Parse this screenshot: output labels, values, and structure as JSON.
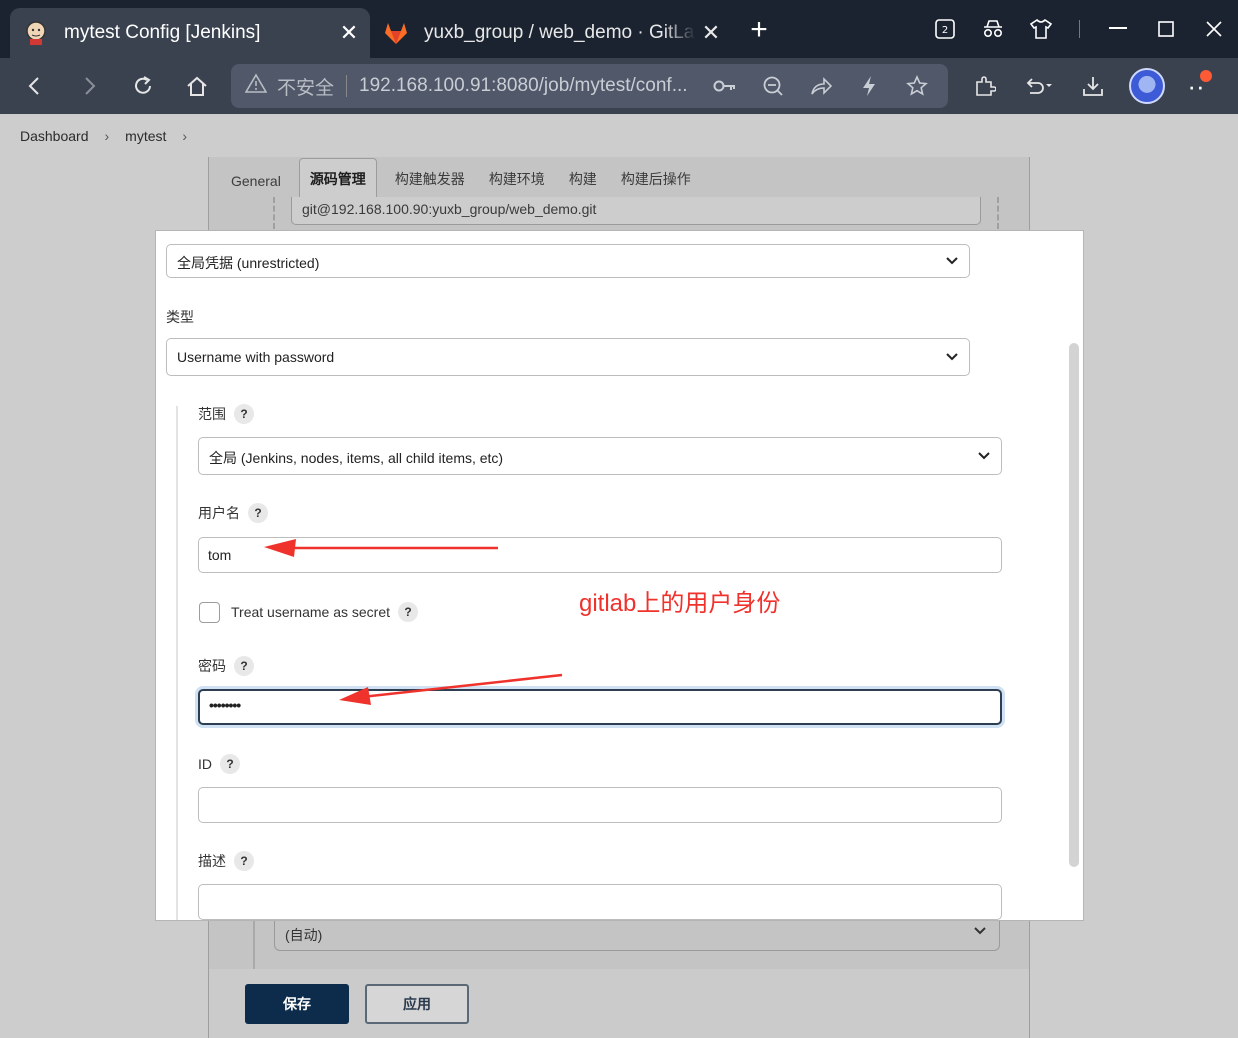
{
  "browser": {
    "tabs": [
      {
        "title": "mytest Config [Jenkins]",
        "active": true,
        "favicon": "jenkins-logo-icon"
      },
      {
        "title": "yuxb_group / web_demo · GitLab",
        "active": false,
        "favicon": "gitlab-logo-icon"
      }
    ],
    "tab_count_badge": "2",
    "address": {
      "security_label": "不安全",
      "url": "192.168.100.91:8080/job/mytest/conf..."
    }
  },
  "breadcrumb": {
    "items": [
      "Dashboard",
      "mytest"
    ]
  },
  "config": {
    "tabs": [
      "General",
      "源码管理",
      "构建触发器",
      "构建环境",
      "构建",
      "构建后操作"
    ],
    "active_tab": "源码管理",
    "repo_url": "git@192.168.100.90:yuxb_group/web_demo.git",
    "branch_select": "(自动)",
    "save_label": "保存",
    "apply_label": "应用"
  },
  "dialog": {
    "domain_select": "全局凭据 (unrestricted)",
    "kind_label": "类型",
    "kind_select": "Username with password",
    "scope_label": "范围",
    "scope_select": "全局 (Jenkins, nodes, items, all child items, etc)",
    "username_label": "用户名",
    "username_value": "tom",
    "treat_secret_label": "Treat username as secret",
    "password_label": "密码",
    "password_value": "••••••••",
    "id_label": "ID",
    "id_value": "",
    "description_label": "描述",
    "description_value": "",
    "help_glyph": "?"
  },
  "annotation": {
    "text": "gitlab上的用户身份",
    "color": "#f0322c"
  },
  "colors": {
    "save_button": "#0d2b4a",
    "titlebar": "#1b2330",
    "toolbar": "#3a4250"
  }
}
